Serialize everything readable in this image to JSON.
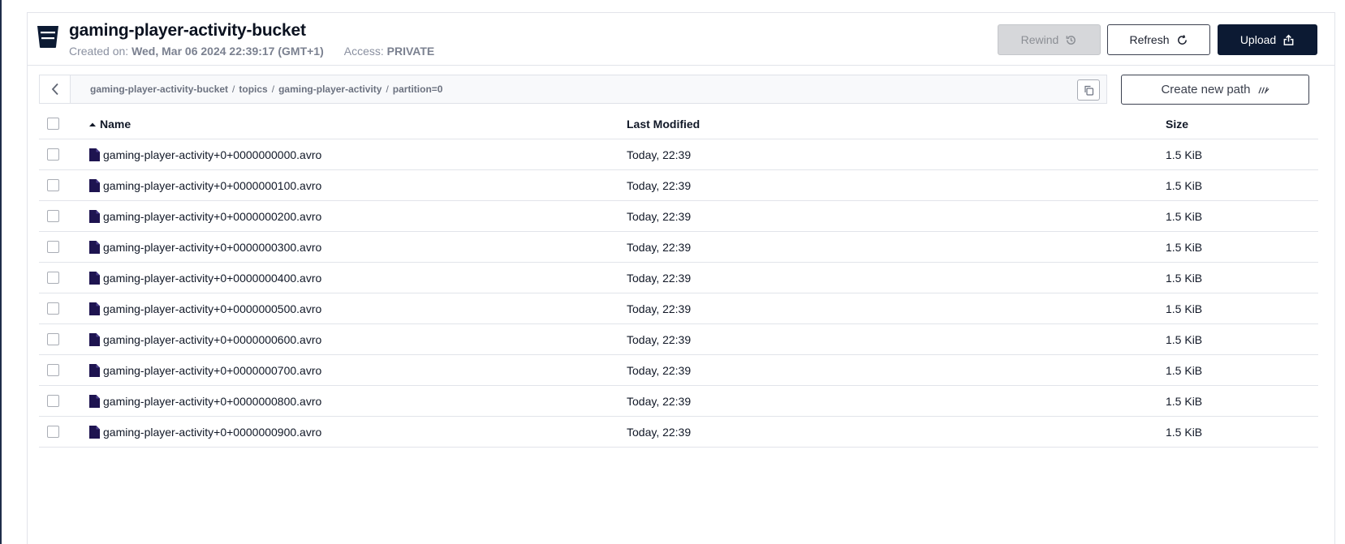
{
  "bucket": {
    "title": "gaming-player-activity-bucket",
    "created_label": "Created on:",
    "created_value": "Wed, Mar 06 2024 22:39:17 (GMT+1)",
    "access_label": "Access:",
    "access_value": "PRIVATE"
  },
  "toolbar": {
    "rewind_label": "Rewind",
    "refresh_label": "Refresh",
    "upload_label": "Upload",
    "create_path_label": "Create new path"
  },
  "path": {
    "segments": [
      "gaming-player-activity-bucket",
      "topics",
      "gaming-player-activity",
      "partition=0"
    ]
  },
  "table": {
    "columns": {
      "name": "Name",
      "modified": "Last Modified",
      "size": "Size"
    },
    "sort": "name-ascending",
    "rows": [
      {
        "name": "gaming-player-activity+0+0000000000.avro",
        "modified": "Today, 22:39",
        "size": "1.5 KiB"
      },
      {
        "name": "gaming-player-activity+0+0000000100.avro",
        "modified": "Today, 22:39",
        "size": "1.5 KiB"
      },
      {
        "name": "gaming-player-activity+0+0000000200.avro",
        "modified": "Today, 22:39",
        "size": "1.5 KiB"
      },
      {
        "name": "gaming-player-activity+0+0000000300.avro",
        "modified": "Today, 22:39",
        "size": "1.5 KiB"
      },
      {
        "name": "gaming-player-activity+0+0000000400.avro",
        "modified": "Today, 22:39",
        "size": "1.5 KiB"
      },
      {
        "name": "gaming-player-activity+0+0000000500.avro",
        "modified": "Today, 22:39",
        "size": "1.5 KiB"
      },
      {
        "name": "gaming-player-activity+0+0000000600.avro",
        "modified": "Today, 22:39",
        "size": "1.5 KiB"
      },
      {
        "name": "gaming-player-activity+0+0000000700.avro",
        "modified": "Today, 22:39",
        "size": "1.5 KiB"
      },
      {
        "name": "gaming-player-activity+0+0000000800.avro",
        "modified": "Today, 22:39",
        "size": "1.5 KiB"
      },
      {
        "name": "gaming-player-activity+0+0000000900.avro",
        "modified": "Today, 22:39",
        "size": "1.5 KiB"
      }
    ]
  },
  "colors": {
    "primary": "#0c1a33",
    "file_icon": "#1e1450",
    "muted_text": "#8a90a0",
    "border": "#e2e4ea"
  },
  "icons": {
    "bucket": "bucket-icon",
    "rewind": "history-icon",
    "refresh": "refresh-icon",
    "upload": "upload-icon",
    "back": "chevron-left-icon",
    "copy": "copy-icon",
    "create_path": "path-icon",
    "sort": "sort-ascending-icon",
    "file": "file-icon"
  }
}
